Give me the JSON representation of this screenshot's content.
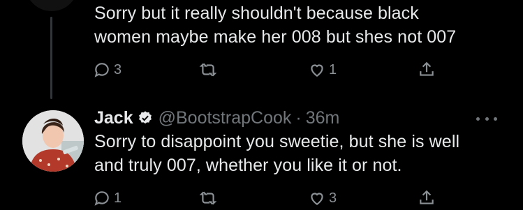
{
  "thread": {
    "reply_1": {
      "text_line_1": "Sorry but it really shouldn't because black",
      "text_line_2": "women maybe make her 008 but shes not 007",
      "reply_count": "3",
      "retweet_count": "",
      "like_count": "1"
    },
    "reply_2": {
      "author_name": "Jack",
      "author_handle": "@BootstrapCook",
      "separator": "·",
      "timestamp": "36m",
      "text_line_1": "Sorry to disappoint you sweetie, but she is well",
      "text_line_2": "and truly 007, whether you like it or not.",
      "reply_count": "1",
      "retweet_count": "",
      "like_count": "3"
    }
  },
  "colors": {
    "background": "#000000",
    "text": "#e7e9ea",
    "muted": "#71767b",
    "verified": "#e7e9ea"
  },
  "icons": [
    "reply-icon",
    "retweet-icon",
    "like-icon",
    "share-icon",
    "verified-badge-icon",
    "more-icon"
  ]
}
